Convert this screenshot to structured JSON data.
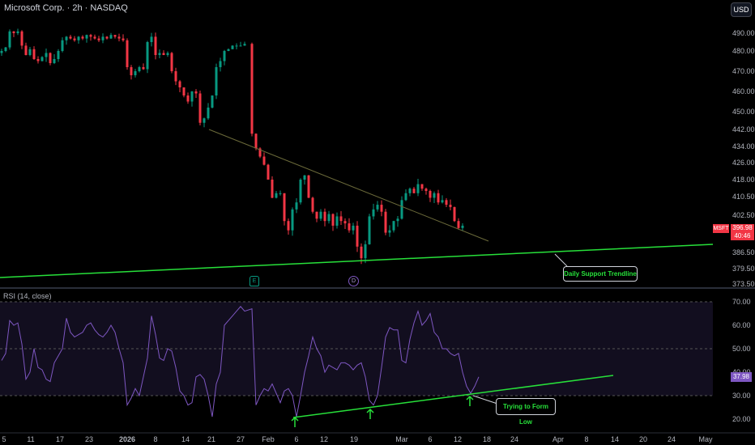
{
  "header": {
    "title": "Microsoft Corp. · 2h · NASDAQ",
    "currency_button": "USD"
  },
  "colors": {
    "up": "#089981",
    "down": "#f23645",
    "support": "#27e03a",
    "downtrend": "#6b6a3a",
    "rsi": "#7e57c2"
  },
  "price_axis": {
    "ticks": [
      490.0,
      480.0,
      470.0,
      460.0,
      450.0,
      442.0,
      434.0,
      426.0,
      418.0,
      410.5,
      402.5,
      386.5,
      379.5,
      373.5
    ],
    "tick_labels": [
      "490.00",
      "480.00",
      "470.00",
      "460.00",
      "450.00",
      "442.00",
      "434.00",
      "426.00",
      "418.00",
      "410.50",
      "402.50",
      "386.50",
      "379.50",
      "373.50"
    ],
    "symbol_badge": "MSFT",
    "last_price": "396.98",
    "countdown": "40:46"
  },
  "time_axis": {
    "labels": [
      "5",
      "11",
      "17",
      "23",
      "2026",
      "8",
      "14",
      "21",
      "27",
      "Feb",
      "6",
      "12",
      "19",
      "Mar",
      "6",
      "12",
      "18",
      "24",
      "Apr",
      "8",
      "14",
      "20",
      "24",
      "May"
    ]
  },
  "price_closes": [
    480,
    482,
    491,
    490,
    491,
    483,
    478,
    481,
    476,
    475,
    477,
    479,
    474,
    476,
    480,
    486,
    488,
    487,
    486,
    488,
    487,
    489,
    488,
    487,
    486,
    488,
    487,
    489,
    488,
    487,
    486,
    472,
    468,
    470,
    472,
    471,
    485,
    488,
    478,
    479,
    478,
    479,
    470,
    465,
    462,
    458,
    455,
    460,
    459,
    445,
    447,
    452,
    458,
    472,
    475,
    480,
    481,
    483,
    483,
    483,
    484,
    440,
    433,
    429,
    425,
    418,
    410,
    412,
    412,
    400,
    396,
    405,
    408,
    418,
    420,
    410,
    404,
    401,
    404,
    400,
    403,
    398,
    402,
    400,
    399,
    396,
    398,
    389,
    384,
    390,
    402,
    405,
    407,
    404,
    395,
    396,
    400,
    401,
    409,
    412,
    414,
    412,
    416,
    414,
    413,
    410,
    412,
    408,
    409,
    407,
    406,
    400,
    397,
    398
  ],
  "price_gap_after_index": 60,
  "markers": {
    "earnings": "E",
    "dividend": "D"
  },
  "annotations": {
    "support_label": "Daily Support Trendline",
    "rsi_label": "Trying to Form Low"
  },
  "rsi": {
    "title": "RSI (14, close)",
    "ticks": [
      "70.00",
      "60.00",
      "50.00",
      "40.00",
      "30.00",
      "20.00"
    ],
    "current": "37.98",
    "upper_band": 70,
    "lower_band": 30,
    "values": [
      45,
      48,
      62,
      60,
      61,
      52,
      37,
      40,
      50,
      42,
      41,
      37,
      36,
      44,
      47,
      50,
      63,
      57,
      55,
      56,
      57,
      60,
      61,
      58,
      56,
      55,
      57,
      60,
      57,
      50,
      44,
      26,
      29,
      33,
      30,
      38,
      46,
      64,
      56,
      46,
      45,
      50,
      49,
      42,
      32,
      30,
      26,
      27,
      38,
      39,
      37,
      30,
      21,
      35,
      40,
      60,
      62,
      64,
      66,
      68,
      66,
      67,
      26,
      30,
      33,
      32,
      35,
      31,
      27,
      32,
      33,
      30,
      21,
      30,
      40,
      47,
      55,
      50,
      47,
      40,
      43,
      42,
      41,
      44,
      44,
      43,
      41,
      43,
      44,
      38,
      28,
      26,
      30,
      42,
      55,
      59,
      58,
      58,
      45,
      44,
      54,
      61,
      66,
      60,
      62,
      65,
      57,
      55,
      50,
      50,
      48,
      47,
      48,
      40,
      34,
      31,
      34,
      38
    ]
  }
}
